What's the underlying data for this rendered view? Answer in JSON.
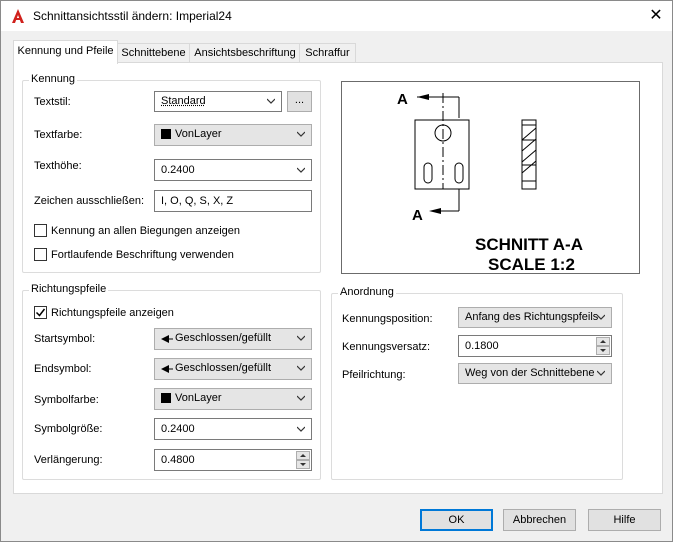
{
  "window": {
    "title": "Schnittansichtsstil ändern: Imperial24",
    "close_glyph": "✕",
    "app_icon": "autocad-a-icon"
  },
  "tabs": [
    {
      "label": "Kennung und Pfeile",
      "active": true
    },
    {
      "label": "Schnittebene",
      "active": false
    },
    {
      "label": "Ansichtsbeschriftung",
      "active": false
    },
    {
      "label": "Schraffur",
      "active": false
    }
  ],
  "kennung": {
    "group_label": "Kennung",
    "textstil": {
      "label": "Textstil:",
      "value": "Standard",
      "browse_label": "..."
    },
    "textfarbe": {
      "label": "Textfarbe:",
      "value": "VonLayer"
    },
    "texthoehe": {
      "label": "Texthöhe:",
      "value": "0.2400"
    },
    "zeichen": {
      "label": "Zeichen ausschließen:",
      "value": "I, O, Q, S, X, Z"
    },
    "check_biegungen": {
      "label": "Kennung an allen Biegungen anzeigen",
      "checked": false
    },
    "check_fortlaufend": {
      "label": "Fortlaufende Beschriftung verwenden",
      "checked": false
    }
  },
  "preview": {
    "label_a_top": "A",
    "label_a_bottom": "A",
    "caption_line1": "SCHNITT A-A",
    "caption_line2": "SCALE 1:2"
  },
  "richtungspfeile": {
    "group_label": "Richtungspfeile",
    "check_anzeigen": {
      "label": "Richtungspfeile anzeigen",
      "checked": true
    },
    "startsymbol": {
      "label": "Startsymbol:",
      "value": "Geschlossen/gefüllt"
    },
    "endsymbol": {
      "label": "Endsymbol:",
      "value": "Geschlossen/gefüllt"
    },
    "symbolfarbe": {
      "label": "Symbolfarbe:",
      "value": "VonLayer"
    },
    "symbolgroesse": {
      "label": "Symbolgröße:",
      "value": "0.2400"
    },
    "verlaengerung": {
      "label": "Verlängerung:",
      "value": "0.4800"
    }
  },
  "anordnung": {
    "group_label": "Anordnung",
    "kennungsposition": {
      "label": "Kennungsposition:",
      "value": "Anfang des Richtungspfeils"
    },
    "kennungsversatz": {
      "label": "Kennungsversatz:",
      "value": "0.1800"
    },
    "pfeilrichtung": {
      "label": "Pfeilrichtung:",
      "value": "Weg von der Schnittebene"
    }
  },
  "buttons": {
    "ok": "OK",
    "abbrechen": "Abbrechen",
    "hilfe": "Hilfe"
  }
}
